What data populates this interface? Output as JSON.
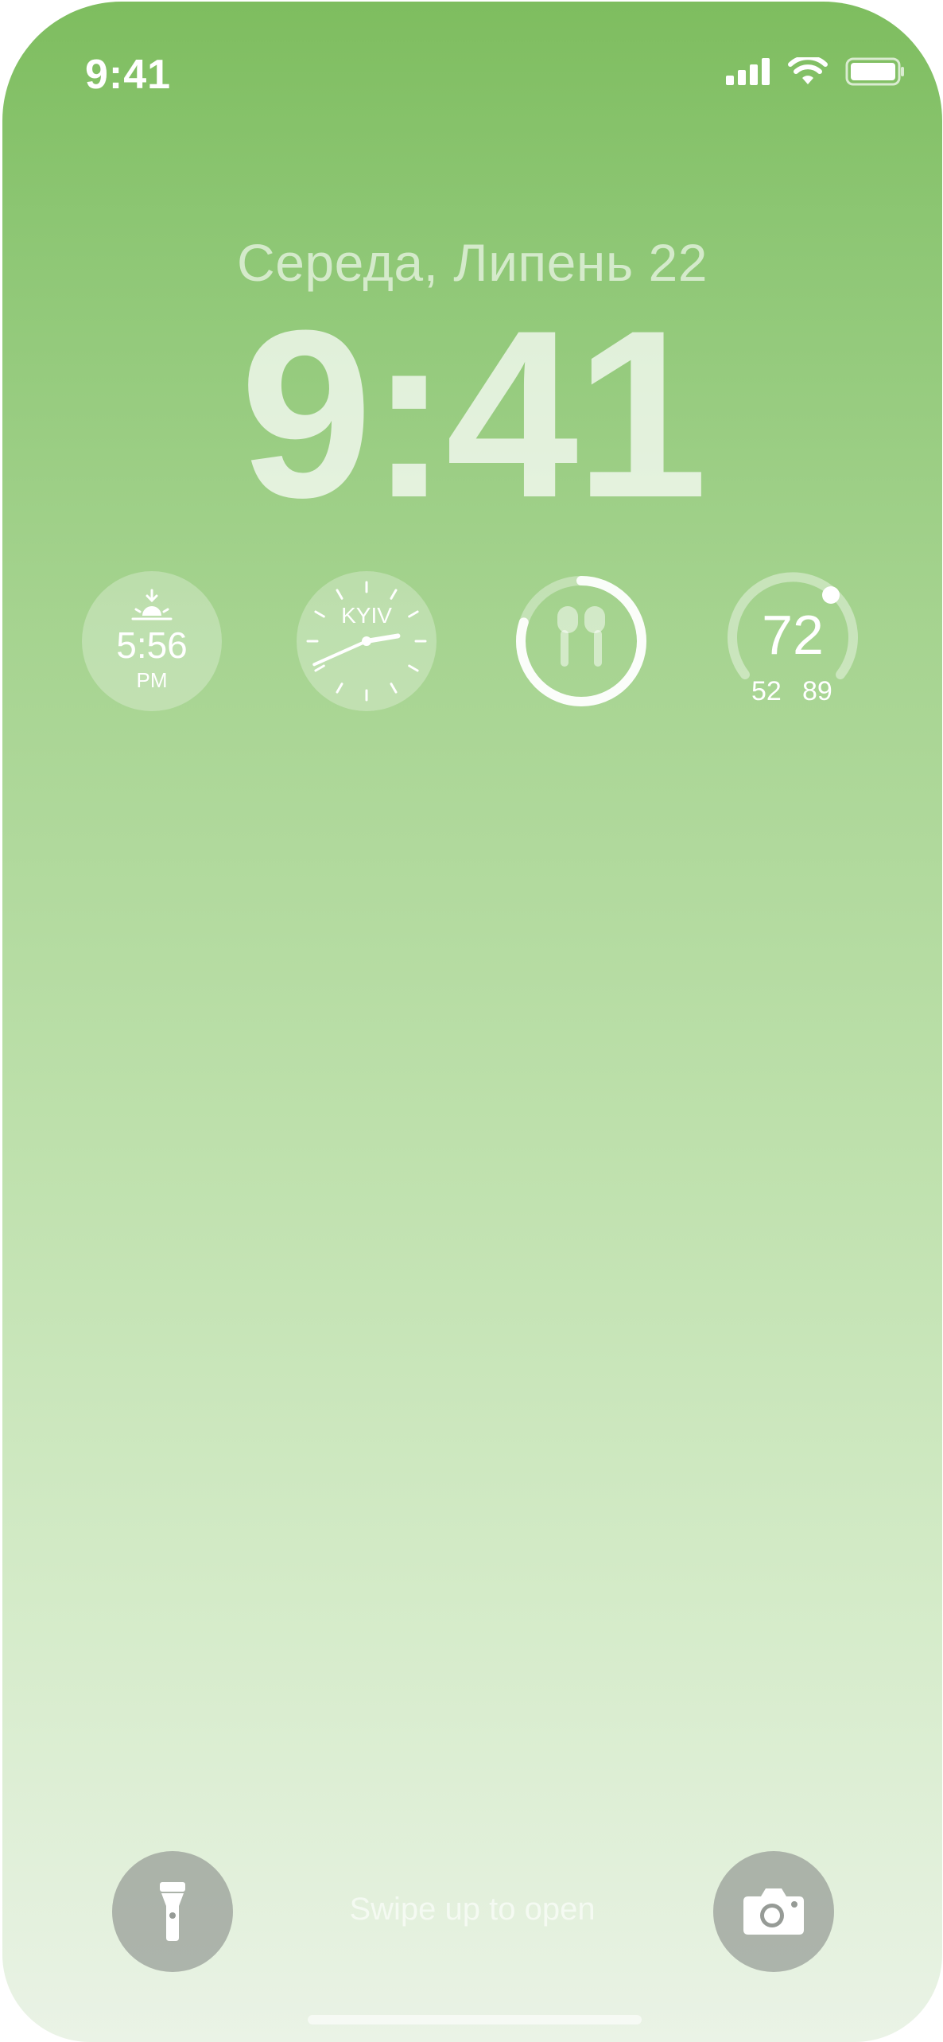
{
  "status_bar": {
    "time": "9:41",
    "icons": [
      "signal-icon",
      "wifi-icon",
      "battery-icon"
    ]
  },
  "lock_screen": {
    "date": "Середа, Липень 22",
    "time": "9:41"
  },
  "widgets": {
    "sunset": {
      "icon": "sunset-icon",
      "time": "5:56",
      "period": "PM"
    },
    "world_clock": {
      "city": "KYIV",
      "hour_hand_time": "2:41"
    },
    "battery": {
      "icon": "airpods-icon",
      "level_percent": 80
    },
    "weather": {
      "current": "72",
      "low": "52",
      "high": "89"
    }
  },
  "bottom": {
    "flashlight_icon": "flashlight-icon",
    "camera_icon": "camera-icon",
    "swipe_hint": "Swipe up to open"
  },
  "colors": {
    "gradient_top": "#7ebd5f",
    "gradient_bottom": "#eaf3e6",
    "button_fill": "#969b96"
  }
}
